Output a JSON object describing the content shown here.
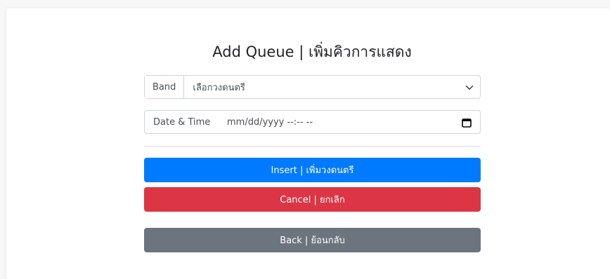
{
  "form": {
    "title": "Add Queue | เพิ่มคิวการแสดง",
    "band": {
      "label": "Band",
      "selected": "เลือกวงดนตรี"
    },
    "datetime": {
      "label": "Date & Time",
      "value": "mm/dd/yyyy --:-- --"
    }
  },
  "buttons": {
    "insert": "Insert | เพิ่มวงดนตรี",
    "cancel": "Cancel | ยกเลิก",
    "back": "Back | ย้อนกลับ"
  },
  "colors": {
    "primary": "#007bff",
    "danger": "#dc3545",
    "secondary": "#6c757d"
  },
  "icons": {
    "select": "chevron-down-icon",
    "date": "calendar-icon"
  }
}
